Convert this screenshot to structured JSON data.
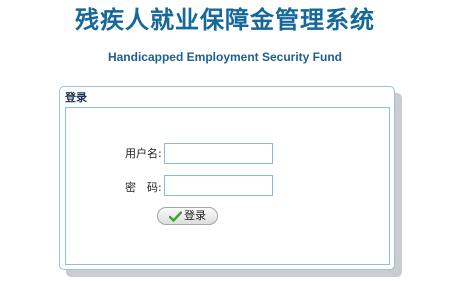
{
  "header": {
    "title": "残疾人就业保障金管理系统",
    "subtitle": "Handicapped Employment Security Fund"
  },
  "login_panel": {
    "title": "登录",
    "username_label": "用户名:",
    "username_value": "",
    "password_label": "密　码:",
    "password_value": "",
    "submit_icon": "checkmark-icon",
    "submit_label": "登录"
  },
  "colors": {
    "title": "#16689b",
    "panel_border": "#8cc0de",
    "check_icon": "#3aa52c"
  }
}
